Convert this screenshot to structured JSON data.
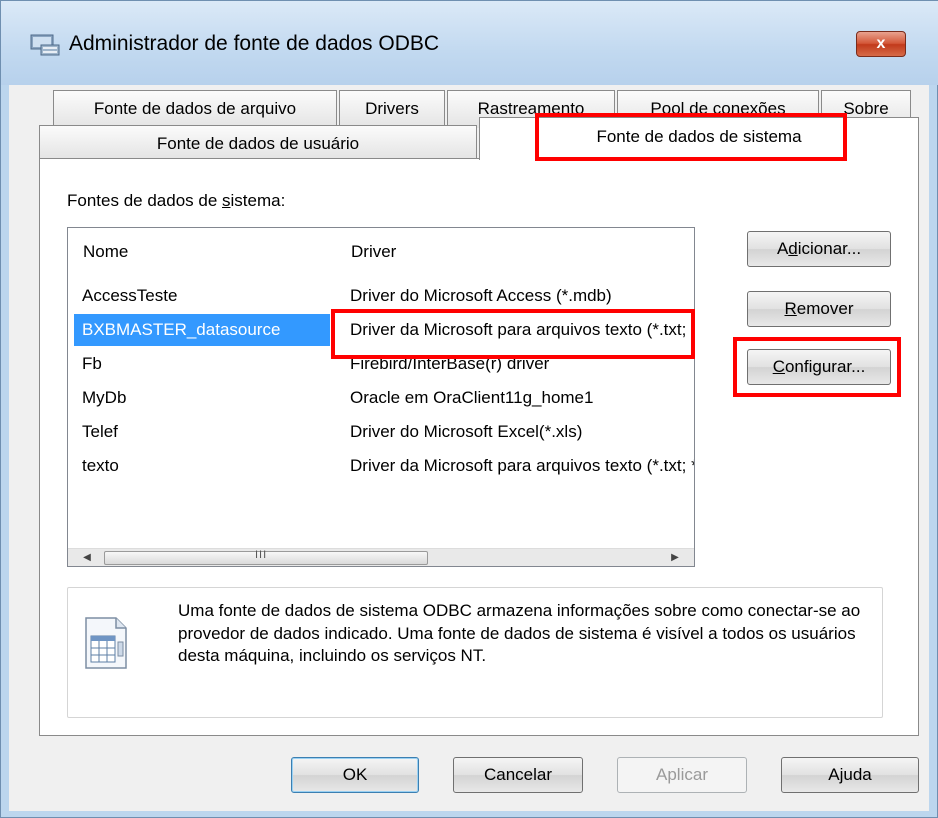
{
  "window": {
    "title": "Administrador de fonte de dados ODBC",
    "close_label": "x"
  },
  "tabs": {
    "row1": [
      "Fonte de dados de arquivo",
      "Drivers",
      "Rastreamento",
      "Pool de conexões",
      "Sobre"
    ],
    "row2": [
      "Fonte de dados de usuário",
      "Fonte de dados de sistema"
    ],
    "active": "Fonte de dados de sistema"
  },
  "panel": {
    "list_label_pre": "Fontes de dados de ",
    "list_label_u": "s",
    "list_label_post": "istema:",
    "columns": [
      "Nome",
      "Driver"
    ],
    "rows": [
      {
        "name": "AccessTeste",
        "driver": "Driver do Microsoft Access (*.mdb)"
      },
      {
        "name": "BXBMASTER_datasource",
        "driver": "Driver da Microsoft para arquivos texto (*.txt; *.csv)",
        "selected": true
      },
      {
        "name": "Fb",
        "driver": "Firebird/InterBase(r) driver"
      },
      {
        "name": "MyDb",
        "driver": "Oracle em OraClient11g_home1"
      },
      {
        "name": "Telef",
        "driver": "Driver do Microsoft Excel(*.xls)"
      },
      {
        "name": "texto",
        "driver": "Driver da Microsoft para arquivos texto (*.txt; *.csv)"
      }
    ],
    "scroll_grip": "III",
    "buttons": {
      "add_pre": "A",
      "add_u": "d",
      "add_post": "icionar...",
      "remove_pre": "",
      "remove_u": "R",
      "remove_post": "emover",
      "configure_pre": "",
      "configure_u": "C",
      "configure_post": "onfigurar..."
    },
    "info_text": "Uma fonte de dados de sistema ODBC armazena informações sobre como conectar-se ao provedor de dados indicado. Uma fonte de dados de sistema é visível a todos os usuários desta máquina, incluindo os serviços NT."
  },
  "footer": {
    "ok": "OK",
    "cancel": "Cancelar",
    "apply": "Aplicar",
    "help": "Ajuda"
  },
  "colors": {
    "highlight_box": "#ff0000",
    "selection": "#3399ff",
    "close_button": "#c13a1b"
  }
}
